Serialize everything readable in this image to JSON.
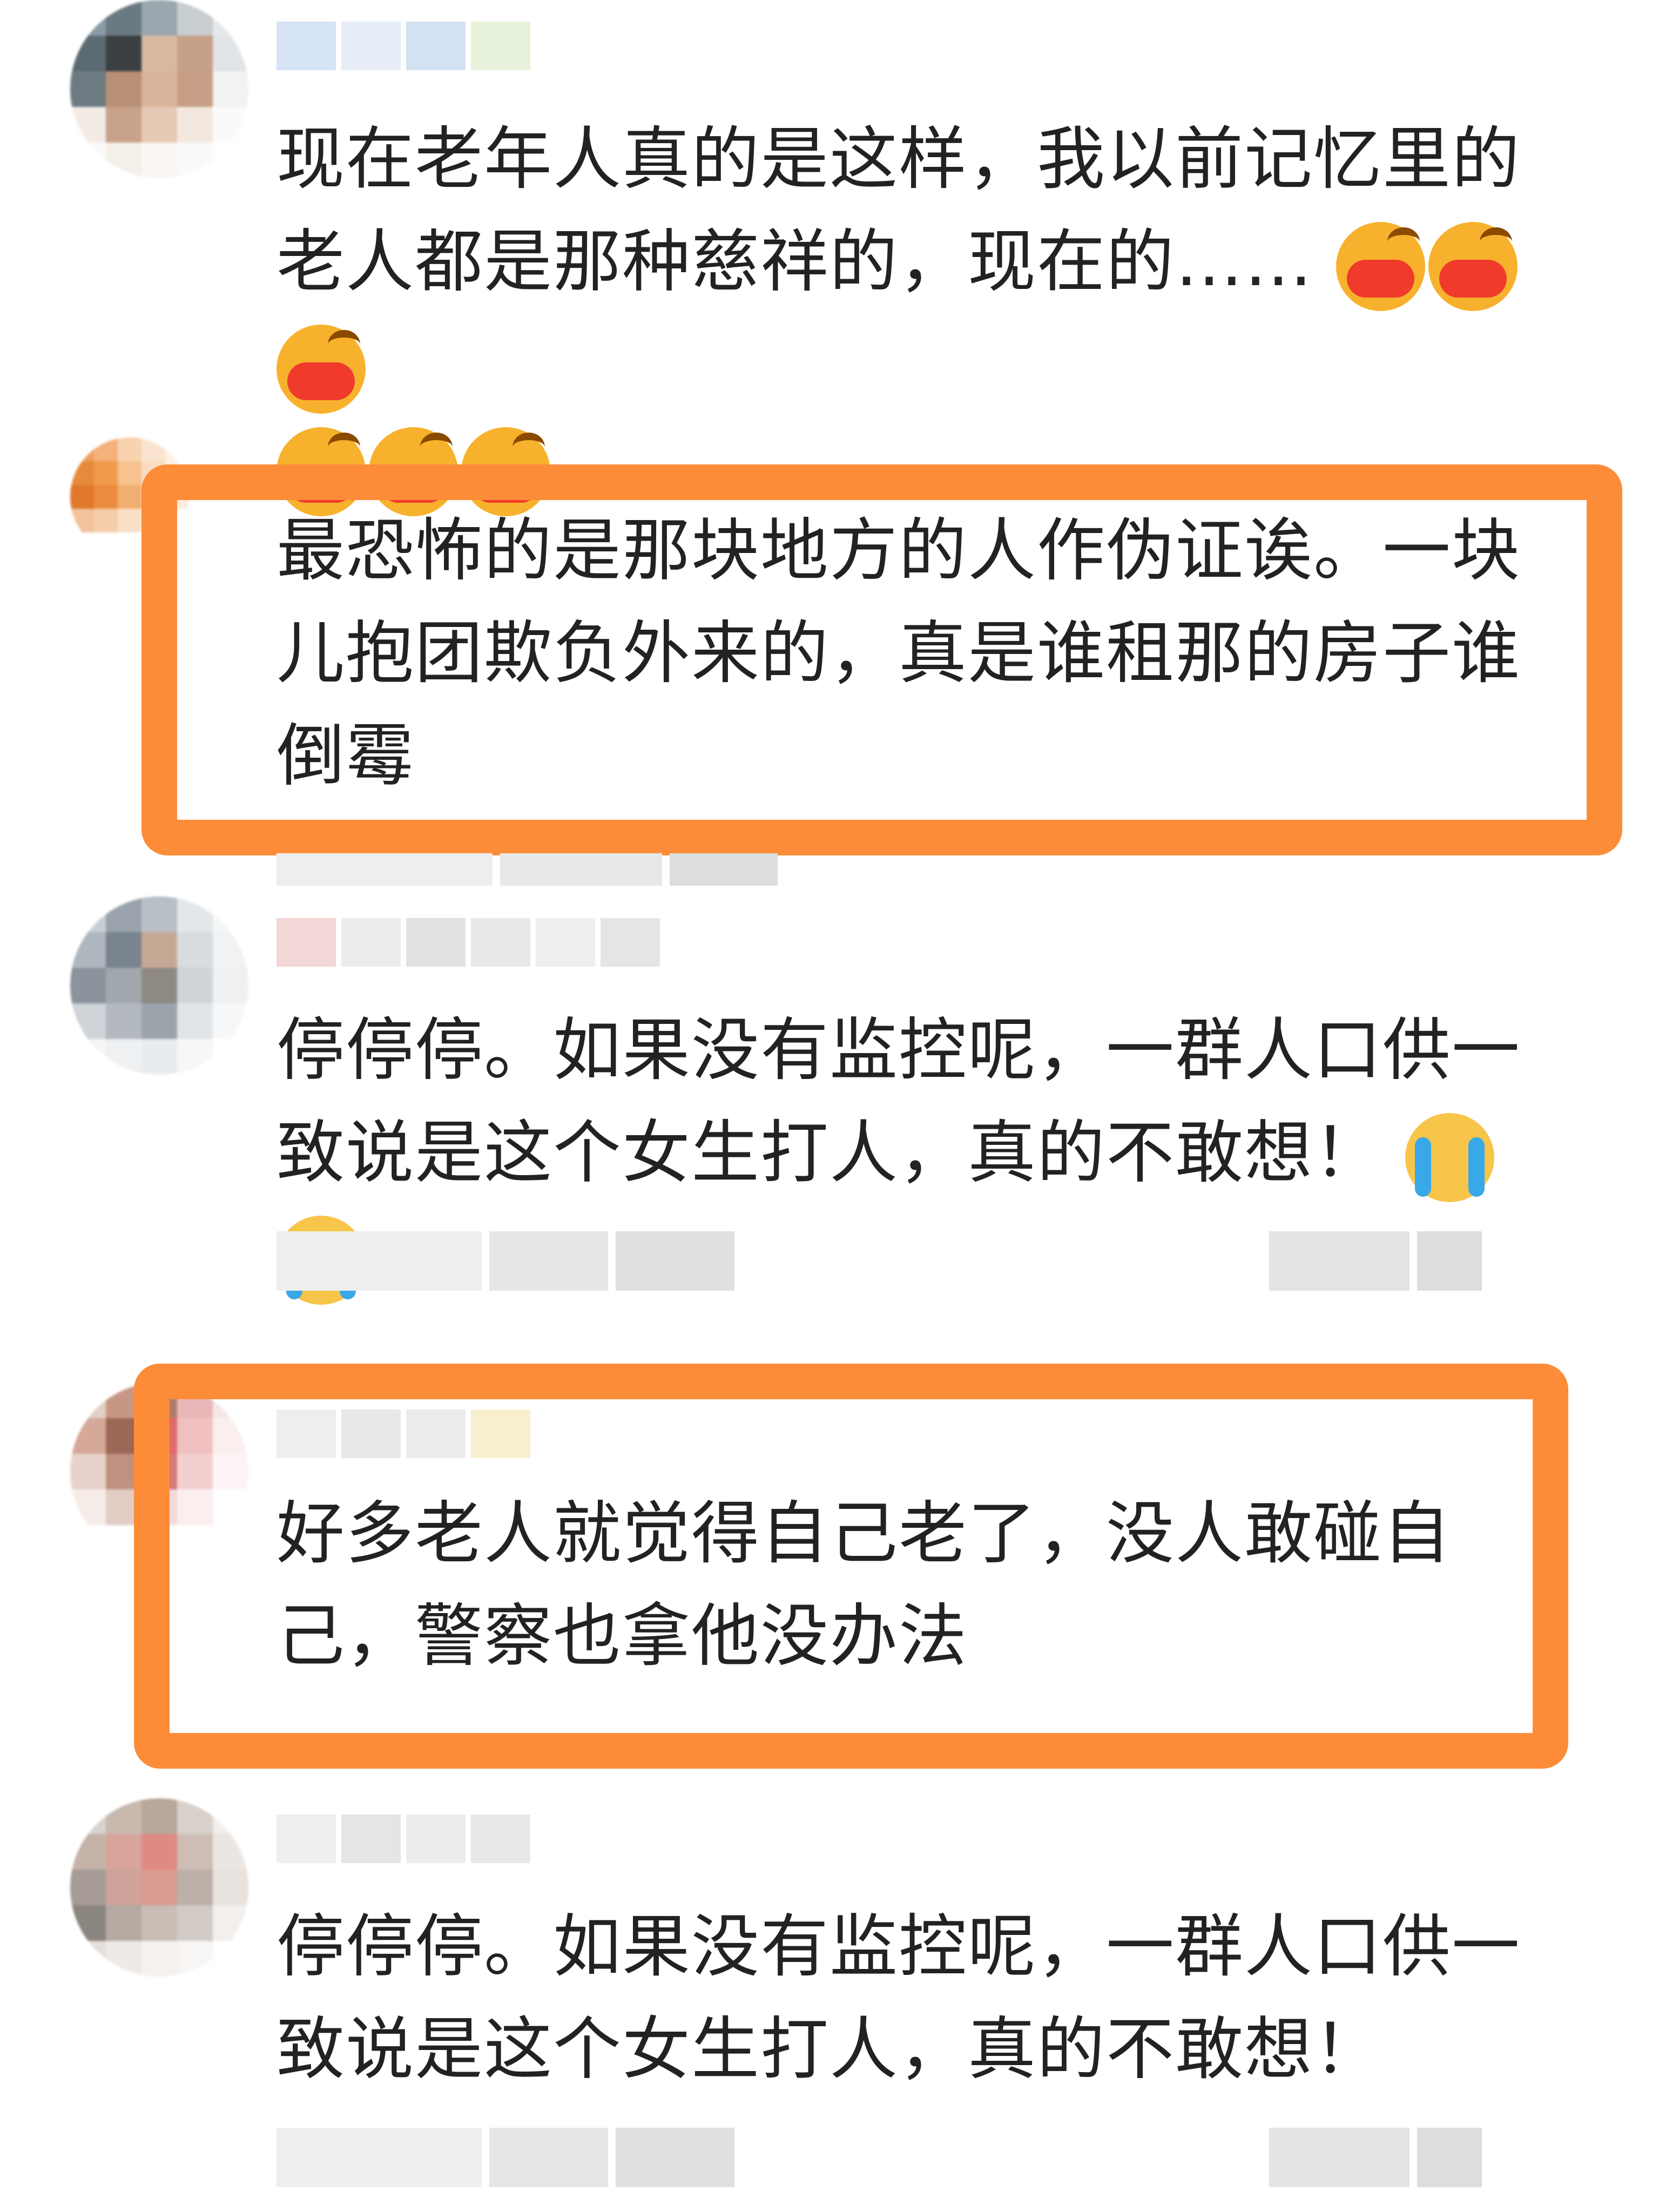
{
  "comments": [
    {
      "text_line1": "现在老年人真的是这样，我以前记忆里的",
      "text_line2": "老人都是那种慈祥的，现在的……",
      "emojis": [
        "kiss-emoji",
        "kiss-emoji",
        "kiss-emoji",
        "kiss-emoji",
        "kiss-emoji",
        "kiss-emoji"
      ]
    },
    {
      "text_line1": "最恐怖的是那块地方的人作伪证诶。一块",
      "text_line2": "儿抱团欺负外来的，真是谁租那的房子谁",
      "text_line3": "倒霉"
    },
    {
      "text_line1": "停停停。如果没有监控呢，一群人口供一",
      "text_line2": "致说是这个女生打人，真的不敢想！",
      "emojis": [
        "crying-emoji",
        "crying-emoji"
      ]
    },
    {
      "text_line1": "好多老人就觉得自己老了，没人敢碰自",
      "text_line2": "己，警察也拿他没办法"
    },
    {
      "text_line1": "停停停。如果没有监控呢，一群人口供一",
      "text_line2": "致说是这个女生打人，真的不敢想！"
    }
  ],
  "colors": {
    "highlight": "#fc8c38",
    "text": "#222222",
    "background": "#ffffff"
  }
}
